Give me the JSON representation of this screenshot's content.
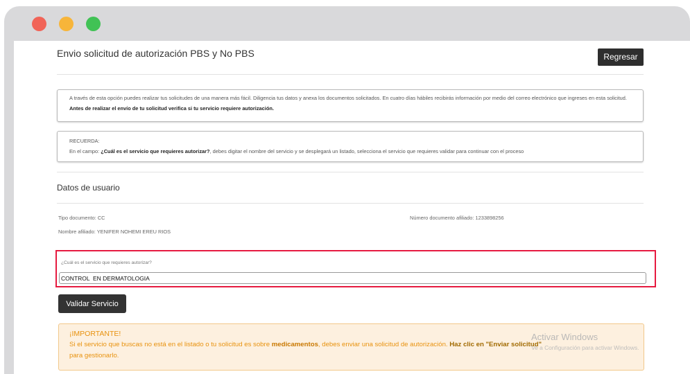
{
  "window": {
    "traffic_lights": {
      "close_color": "#f16458",
      "minimize_color": "#f7b53a",
      "maximize_color": "#41c255"
    }
  },
  "page": {
    "title": "Envio solicitud de autorización PBS y No PBS",
    "back_button": "Regresar"
  },
  "info_box": {
    "text": "A través de esta opción puedes realizar tus solicitudes de una manera más fácil. Diligencia tus datos y anexa los documentos solicitados. En cuatro días hábiles recibirás información por medio del correo electrónico que ingreses en esta solicitud. ",
    "bold": "Antes de realizar el envío de tu solicitud verifica si tu servicio requiere autorización."
  },
  "reminder_box": {
    "title": "RECUERDA:",
    "prefix": "En el campo: ",
    "bold": "¿Cuál es el servicio que requieres autorizar?",
    "suffix": ", debes digitar el nombre del servicio y se desplegará un listado, selecciona el servicio que requieres validar para continuar con el proceso"
  },
  "user_data": {
    "section_title": "Datos de usuario",
    "doc_type": "Tipo documento: CC",
    "doc_number": "Número documento afiliado: 1233898256",
    "affiliate_name": "Nombre afiliado: YENIFER NOHEMI EREU RIOS"
  },
  "service": {
    "question": "¿Cuál es el servicio que requieres autorizar?",
    "value": "CONTROL  EN DERMATOLOGIA",
    "highlight_color": "#e6193f",
    "validate_button": "Validar Servicio"
  },
  "alert": {
    "title": "¡IMPORTANTE!",
    "text1": "Si el servicio que buscas no está en el listado o tu solicitud es sobre ",
    "bold1": "medicamentos",
    "text2": ", debes enviar una solicitud de autorización. ",
    "link": "Haz clic en \"Enviar solicitud\"",
    "text3": " para gestionarlo."
  },
  "watermark": {
    "title": "Activar Windows",
    "subtitle": "Ve a Configuración para activar Windows."
  }
}
